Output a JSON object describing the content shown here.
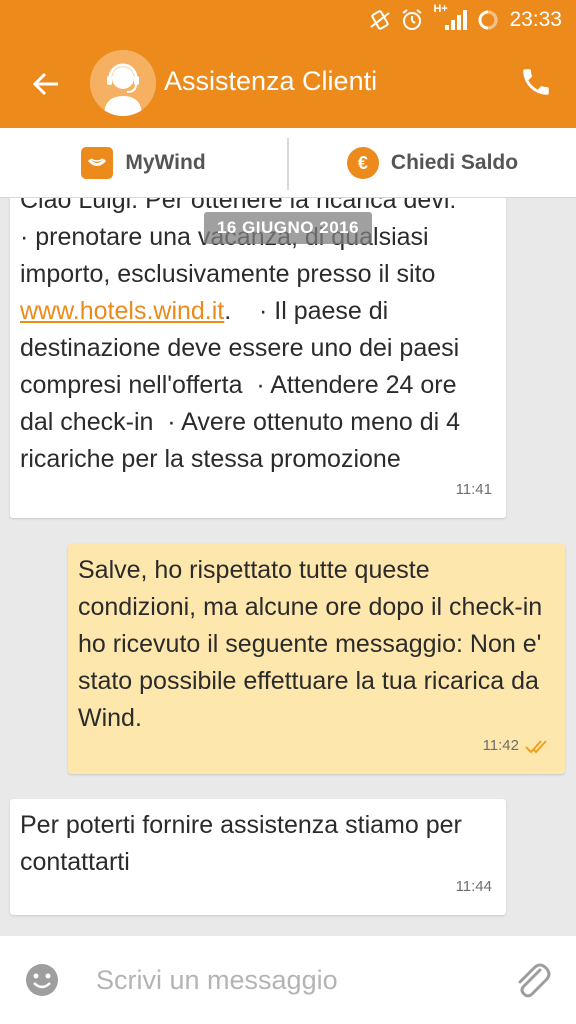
{
  "status_bar": {
    "time": "23:33",
    "network": "H+"
  },
  "app_bar": {
    "title": "Assistenza Clienti"
  },
  "tabs": [
    {
      "label": "MyWind"
    },
    {
      "label": "Chiedi Saldo"
    }
  ],
  "chat": {
    "date_chip": "16 GIUGNO 2016",
    "messages": [
      {
        "direction": "incoming",
        "partial_top": "Ciao Luigi. Per ottenere la ricarica devi:",
        "before_link": "· prenotare una vacanza, di qualsiasi importo, esclusivamente presso il sito ",
        "link": "www.hotels.wind.it",
        "after_link": ".    · Il paese di destinazione deve essere uno dei paesi compresi nell'offerta  · Attendere 24 ore dal check-in  · Avere ottenuto meno di 4 ricariche per la stessa promozione",
        "time": "11:41"
      },
      {
        "direction": "outgoing",
        "text": "Salve, ho rispettato tutte queste condizioni, ma alcune ore dopo il check-in ho ricevuto il seguente messaggio: Non e' stato possibile effettuare la tua ricarica da Wind.",
        "time": "11:42",
        "status": "read"
      },
      {
        "direction": "incoming",
        "text": "Per poterti fornire assistenza stiamo per contattarti",
        "time": "11:44"
      }
    ]
  },
  "compose": {
    "placeholder": "Scrivi un messaggio"
  },
  "colors": {
    "brand": "#ec8a1c",
    "outgoing_bubble": "#fde7ad",
    "read_ticks": "#f0a020"
  }
}
